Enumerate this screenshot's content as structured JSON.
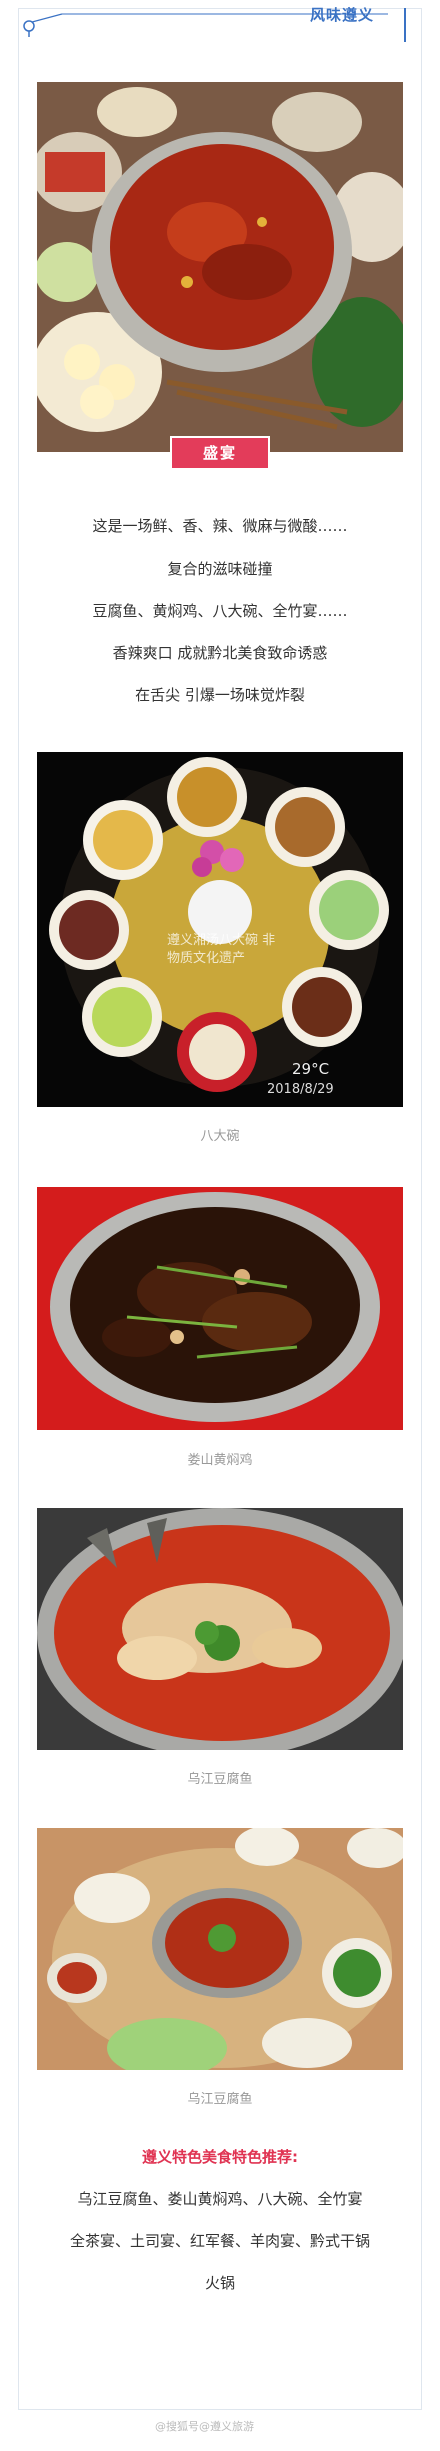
{
  "header": {
    "title": "风味遵义"
  },
  "hero": {
    "tag": "盛宴"
  },
  "intro_lines": [
    "这是一场鲜、香、辣、微麻与微酸……",
    "复合的滋味碰撞",
    "豆腐鱼、黄焖鸡、八大碗、全竹宴……",
    "香辣爽口  成就黔北美食致命诱惑",
    "在舌尖 引爆一场味觉炸裂"
  ],
  "photos": [
    {
      "caption": "八大碗",
      "overlay": "遵义湘汤八大碗 非物质文化遗产",
      "temp": "29°C",
      "date": "2018/8/29"
    },
    {
      "caption": "娄山黄焖鸡"
    },
    {
      "caption": "乌江豆腐鱼"
    },
    {
      "caption": "乌江豆腐鱼"
    }
  ],
  "recommend": {
    "title": "遵义特色美食特色推荐:",
    "lines": [
      "乌江豆腐鱼、娄山黄焖鸡、八大碗、全竹宴",
      "全茶宴、土司宴、红军餐、羊肉宴、黔式干锅",
      "火锅"
    ]
  },
  "watermark": "@搜狐号@遵义旅游"
}
